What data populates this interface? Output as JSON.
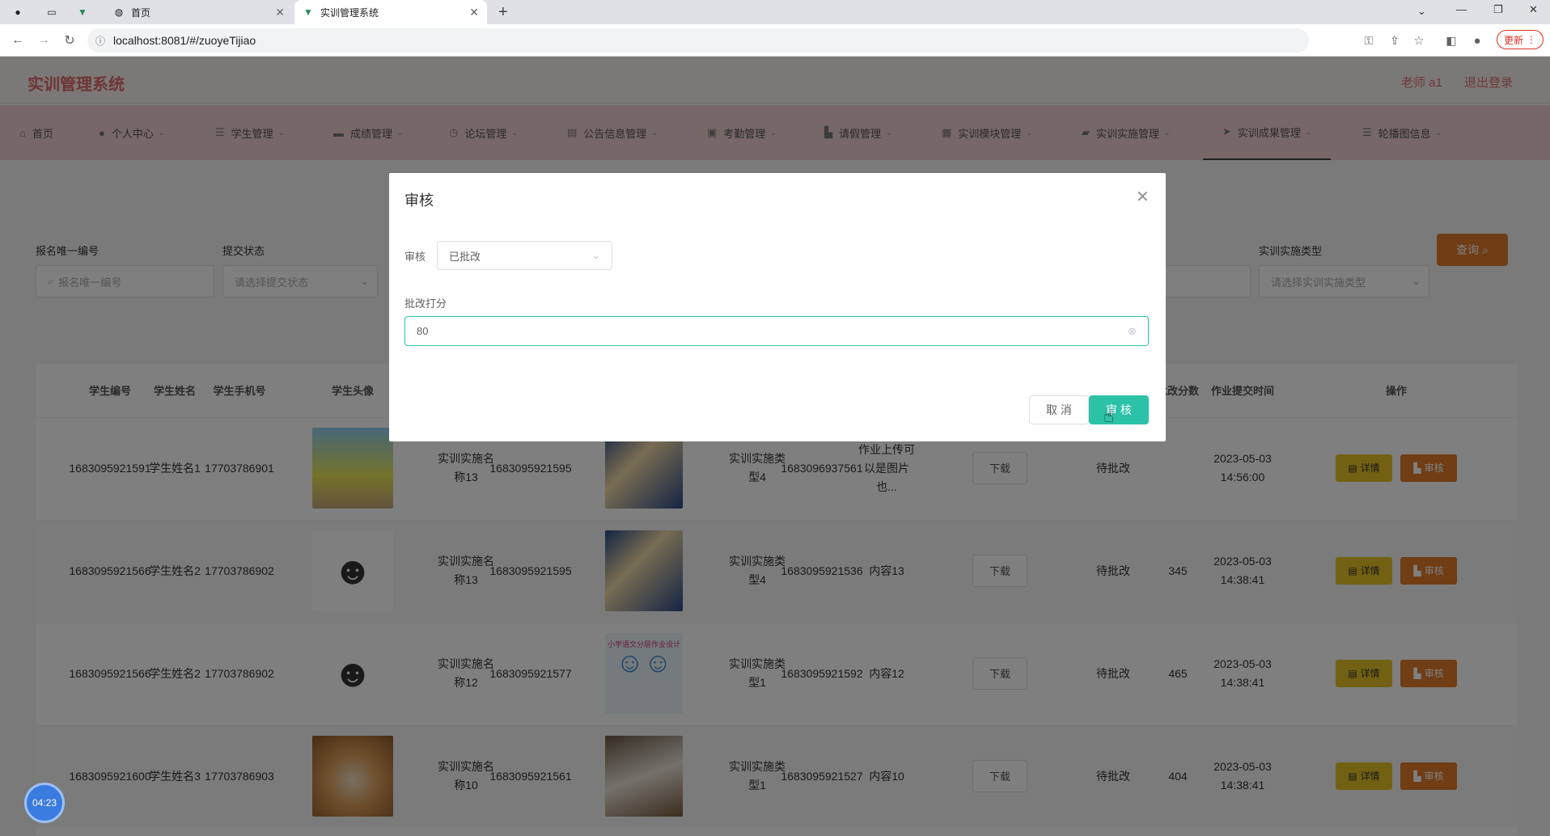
{
  "browser": {
    "tabs": [
      {
        "label": "",
        "icon": "github-icon"
      },
      {
        "label": "",
        "icon": "blank-page-icon"
      },
      {
        "label": "",
        "icon": "vue-icon"
      },
      {
        "label": "首页",
        "icon": "globe-icon"
      },
      {
        "label": "实训管理系统",
        "icon": "vue-icon"
      }
    ],
    "url": "localhost:8081/#/zuoyeTijiao",
    "update_label": "更新"
  },
  "app": {
    "brand": "实训管理系统",
    "user": "老师 a1",
    "logout": "退出登录",
    "menu": [
      {
        "label": "首页",
        "icon": "home-icon"
      },
      {
        "label": "个人中心",
        "icon": "user-icon"
      },
      {
        "label": "学生管理",
        "icon": "list-icon"
      },
      {
        "label": "成绩管理",
        "icon": "folder-icon"
      },
      {
        "label": "论坛管理",
        "icon": "clock-icon"
      },
      {
        "label": "公告信息管理",
        "icon": "document-icon"
      },
      {
        "label": "考勤管理",
        "icon": "clipboard-icon"
      },
      {
        "label": "请假管理",
        "icon": "thumb-icon"
      },
      {
        "label": "实训模块管理",
        "icon": "grid-icon"
      },
      {
        "label": "实训实施管理",
        "icon": "bag-icon"
      },
      {
        "label": "实训成果管理",
        "icon": "send-icon"
      },
      {
        "label": "轮播图信息",
        "icon": "menu-icon"
      }
    ]
  },
  "filters": {
    "baoming_label": "报名唯一编号",
    "baoming_placeholder": "报名唯一编号",
    "status_label": "提交状态",
    "status_placeholder": "请选择提交状态",
    "type_label": "实训实施类型",
    "type_placeholder": "请选择实训实施类型",
    "query_label": "查询"
  },
  "table": {
    "headers": {
      "student_no": "学生编号",
      "student_name": "学生姓名",
      "student_phone": "学生手机号",
      "student_avatar": "学生头像",
      "score": "批改分数",
      "submit_time": "作业提交时间",
      "actions": "操作"
    },
    "rows": [
      {
        "student_no": "1683095921591",
        "student_name": "学生姓名1",
        "phone": "17703786901",
        "impl_name": "实训实施名称13",
        "impl_no": "1683095921595",
        "impl_type": "实训实施类型4",
        "submit_no": "1683096937561",
        "content": "作业上传可以是图片也...",
        "status": "待批改",
        "score": "",
        "time": "2023-05-03 14:56:00"
      },
      {
        "student_no": "1683095921566",
        "student_name": "学生姓名2",
        "phone": "17703786902",
        "impl_name": "实训实施名称13",
        "impl_no": "1683095921595",
        "impl_type": "实训实施类型4",
        "submit_no": "1683095921536",
        "content": "内容13",
        "status": "待批改",
        "score": "345",
        "time": "2023-05-03 14:38:41"
      },
      {
        "student_no": "1683095921566",
        "student_name": "学生姓名2",
        "phone": "17703786902",
        "impl_name": "实训实施名称12",
        "impl_no": "1683095921577",
        "impl_type": "实训实施类型1",
        "submit_no": "1683095921592",
        "content": "内容12",
        "status": "待批改",
        "score": "465",
        "time": "2023-05-03 14:38:41"
      },
      {
        "student_no": "1683095921600",
        "student_name": "学生姓名3",
        "phone": "17703786903",
        "impl_name": "实训实施名称10",
        "impl_no": "1683095921561",
        "impl_type": "实训实施类型1",
        "submit_no": "1683095921527",
        "content": "内容10",
        "status": "待批改",
        "score": "404",
        "time": "2023-05-03 14:38:41"
      }
    ],
    "download_label": "下载",
    "detail_label": "详情",
    "audit_label": "审核",
    "work_image_caption": "小学语文分层作业设计"
  },
  "dialog": {
    "title": "审核",
    "audit_label": "审核",
    "audit_value": "已批改",
    "score_label": "批改打分",
    "score_value": "80",
    "cancel_label": "取 消",
    "ok_label": "审 核"
  },
  "timer": "04:23",
  "colors": {
    "accent": "#2cc2a8",
    "brand": "#e06a6a",
    "warning": "#e07b2a",
    "detail": "#e6c227"
  }
}
